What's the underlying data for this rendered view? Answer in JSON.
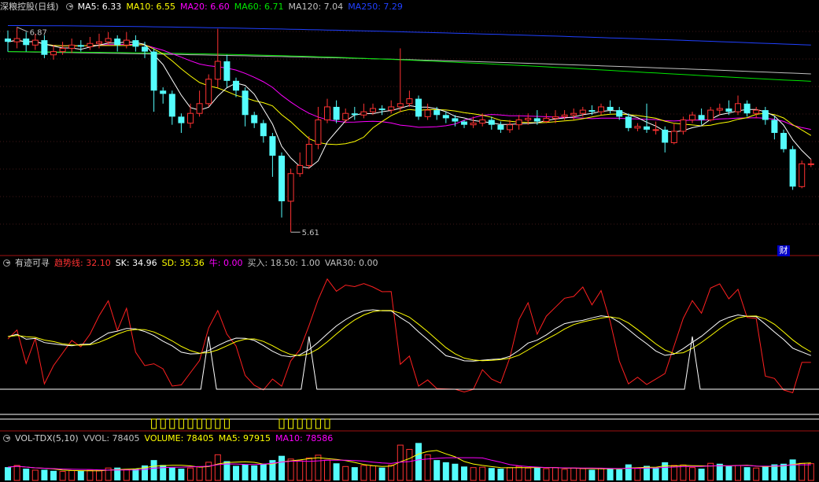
{
  "colors": {
    "up": "#ff3232",
    "down": "#54fcfc",
    "ma5": "#ffffff",
    "ma10": "#ffff00",
    "ma20": "#ff00ff",
    "ma60": "#00e600",
    "ma120": "#c0c0c0",
    "ma250": "#2040ff"
  },
  "main": {
    "title": "深粮控股(日线)",
    "ma5_label": "MA5: 6.33",
    "ma10_label": "MA10: 6.55",
    "ma20_label": "MA20: 6.60",
    "ma60_label": "MA60: 6.71",
    "ma120_label": "MA120: 7.04",
    "ma250_label": "MA250: 7.29",
    "high_label": "6.87",
    "low_label": "5.61",
    "cai_badge": "财"
  },
  "indicator": {
    "title": "有迹可寻",
    "trend_label": "趋势线: 32.10",
    "sk_label": "SK: 34.96",
    "sd_label": "SD: 35.36",
    "niu_label": "牛: 0.00",
    "buy_label": "买入: 18.50",
    "extra_label": ": 1.00",
    "var30_label": "VAR30: 0.00"
  },
  "volume": {
    "title": "VOL-TDX(5,10)",
    "vvol_label": "VVOL: 78405",
    "volume_label": "VOLUME: 78405",
    "ma5_label": "MA5: 97915",
    "ma10_label": "MA10: 78586"
  },
  "chart_data": {
    "type": "candlestick",
    "price_range": [
      5.5,
      6.95
    ],
    "candles": [
      [
        6.8,
        6.78,
        6.85,
        6.72
      ],
      [
        6.78,
        6.8,
        6.87,
        6.74
      ],
      [
        6.8,
        6.76,
        6.84,
        6.72
      ],
      [
        6.76,
        6.79,
        6.83,
        6.73
      ],
      [
        6.79,
        6.7,
        6.82,
        6.68
      ],
      [
        6.7,
        6.72,
        6.76,
        6.67
      ],
      [
        6.72,
        6.74,
        6.78,
        6.7
      ],
      [
        6.74,
        6.76,
        6.8,
        6.71
      ],
      [
        6.76,
        6.75,
        6.79,
        6.72
      ],
      [
        6.75,
        6.77,
        6.81,
        6.73
      ],
      [
        6.77,
        6.78,
        6.83,
        6.74
      ],
      [
        6.78,
        6.8,
        6.84,
        6.76
      ],
      [
        6.8,
        6.76,
        6.82,
        6.72
      ],
      [
        6.76,
        6.79,
        6.84,
        6.74
      ],
      [
        6.79,
        6.75,
        6.82,
        6.72
      ],
      [
        6.75,
        6.72,
        6.78,
        6.68
      ],
      [
        6.72,
        6.48,
        6.74,
        6.35
      ],
      [
        6.48,
        6.46,
        6.5,
        6.4
      ],
      [
        6.46,
        6.32,
        6.48,
        6.27
      ],
      [
        6.32,
        6.28,
        6.34,
        6.22
      ],
      [
        6.28,
        6.34,
        6.4,
        6.25
      ],
      [
        6.34,
        6.4,
        6.48,
        6.32
      ],
      [
        6.4,
        6.55,
        6.58,
        6.38
      ],
      [
        6.55,
        6.66,
        6.86,
        6.5
      ],
      [
        6.66,
        6.54,
        6.7,
        6.5
      ],
      [
        6.54,
        6.48,
        6.56,
        6.44
      ],
      [
        6.48,
        6.33,
        6.5,
        6.26
      ],
      [
        6.33,
        6.28,
        6.35,
        6.25
      ],
      [
        6.28,
        6.2,
        6.3,
        6.16
      ],
      [
        6.2,
        6.08,
        6.22,
        5.95
      ],
      [
        6.08,
        5.8,
        6.1,
        5.7
      ],
      [
        5.8,
        5.97,
        6.0,
        5.61
      ],
      [
        5.97,
        6.02,
        6.1,
        5.95
      ],
      [
        6.02,
        6.15,
        6.2,
        6.0
      ],
      [
        6.15,
        6.3,
        6.38,
        6.12
      ],
      [
        6.3,
        6.38,
        6.43,
        6.28
      ],
      [
        6.38,
        6.3,
        6.42,
        6.28
      ],
      [
        6.3,
        6.34,
        6.37,
        6.28
      ],
      [
        6.34,
        6.33,
        6.38,
        6.3
      ],
      [
        6.33,
        6.35,
        6.4,
        6.31
      ],
      [
        6.35,
        6.37,
        6.4,
        6.33
      ],
      [
        6.37,
        6.36,
        6.39,
        6.33
      ],
      [
        6.36,
        6.38,
        6.42,
        6.34
      ],
      [
        6.38,
        6.4,
        6.74,
        6.35
      ],
      [
        6.4,
        6.43,
        6.48,
        6.38
      ],
      [
        6.43,
        6.32,
        6.45,
        6.3
      ],
      [
        6.32,
        6.36,
        6.4,
        6.3
      ],
      [
        6.36,
        6.33,
        6.38,
        6.3
      ],
      [
        6.33,
        6.31,
        6.35,
        6.28
      ],
      [
        6.31,
        6.29,
        6.33,
        6.26
      ],
      [
        6.29,
        6.27,
        6.3,
        6.25
      ],
      [
        6.27,
        6.28,
        6.32,
        6.25
      ],
      [
        6.28,
        6.3,
        6.34,
        6.26
      ],
      [
        6.3,
        6.27,
        6.32,
        6.24
      ],
      [
        6.27,
        6.24,
        6.29,
        6.22
      ],
      [
        6.24,
        6.27,
        6.3,
        6.22
      ],
      [
        6.27,
        6.3,
        6.33,
        6.24
      ],
      [
        6.3,
        6.31,
        6.34,
        6.27
      ],
      [
        6.31,
        6.29,
        6.36,
        6.27
      ],
      [
        6.29,
        6.31,
        6.34,
        6.28
      ],
      [
        6.31,
        6.32,
        6.36,
        6.28
      ],
      [
        6.32,
        6.33,
        6.36,
        6.3
      ],
      [
        6.33,
        6.34,
        6.37,
        6.3
      ],
      [
        6.34,
        6.36,
        6.38,
        6.32
      ],
      [
        6.36,
        6.35,
        6.39,
        6.33
      ],
      [
        6.35,
        6.38,
        6.4,
        6.33
      ],
      [
        6.38,
        6.36,
        6.42,
        6.34
      ],
      [
        6.36,
        6.32,
        6.38,
        6.3
      ],
      [
        6.32,
        6.25,
        6.34,
        6.23
      ],
      [
        6.25,
        6.26,
        6.28,
        6.23
      ],
      [
        6.26,
        6.24,
        6.4,
        6.22
      ],
      [
        6.24,
        6.24,
        6.29,
        6.21
      ],
      [
        6.24,
        6.16,
        6.26,
        6.1
      ],
      [
        6.16,
        6.23,
        6.28,
        6.15
      ],
      [
        6.23,
        6.3,
        6.32,
        6.21
      ],
      [
        6.3,
        6.33,
        6.35,
        6.28
      ],
      [
        6.33,
        6.3,
        6.37,
        6.27
      ],
      [
        6.3,
        6.36,
        6.38,
        6.29
      ],
      [
        6.36,
        6.37,
        6.4,
        6.33
      ],
      [
        6.37,
        6.35,
        6.42,
        6.33
      ],
      [
        6.35,
        6.4,
        6.45,
        6.33
      ],
      [
        6.4,
        6.34,
        6.42,
        6.32
      ],
      [
        6.34,
        6.36,
        6.38,
        6.31
      ],
      [
        6.36,
        6.3,
        6.38,
        6.27
      ],
      [
        6.3,
        6.22,
        6.32,
        6.18
      ],
      [
        6.22,
        6.12,
        6.24,
        6.1
      ],
      [
        6.12,
        5.89,
        6.14,
        5.87
      ],
      [
        5.89,
        6.03,
        6.05,
        5.88
      ],
      [
        6.03,
        6.03,
        6.06,
        6.01
      ]
    ],
    "volume_range": [
      0,
      180000
    ],
    "volumes": [
      [
        62000,
        "down"
      ],
      [
        70000,
        "up"
      ],
      [
        55000,
        "down"
      ],
      [
        48000,
        "up"
      ],
      [
        50000,
        "down"
      ],
      [
        45000,
        "down"
      ],
      [
        42000,
        "up"
      ],
      [
        46000,
        "up"
      ],
      [
        44000,
        "down"
      ],
      [
        47000,
        "up"
      ],
      [
        45000,
        "up"
      ],
      [
        58000,
        "up"
      ],
      [
        60000,
        "down"
      ],
      [
        52000,
        "up"
      ],
      [
        55000,
        "down"
      ],
      [
        70000,
        "down"
      ],
      [
        95000,
        "down"
      ],
      [
        72000,
        "down"
      ],
      [
        60000,
        "down"
      ],
      [
        55000,
        "down"
      ],
      [
        58000,
        "up"
      ],
      [
        65000,
        "up"
      ],
      [
        85000,
        "up"
      ],
      [
        120000,
        "up"
      ],
      [
        90000,
        "down"
      ],
      [
        68000,
        "down"
      ],
      [
        75000,
        "down"
      ],
      [
        70000,
        "down"
      ],
      [
        78000,
        "down"
      ],
      [
        95000,
        "down"
      ],
      [
        115000,
        "down"
      ],
      [
        100000,
        "up"
      ],
      [
        92000,
        "up"
      ],
      [
        105000,
        "up"
      ],
      [
        118000,
        "up"
      ],
      [
        95000,
        "up"
      ],
      [
        80000,
        "down"
      ],
      [
        65000,
        "up"
      ],
      [
        62000,
        "down"
      ],
      [
        70000,
        "up"
      ],
      [
        68000,
        "up"
      ],
      [
        60000,
        "down"
      ],
      [
        72000,
        "up"
      ],
      [
        165000,
        "up"
      ],
      [
        145000,
        "up"
      ],
      [
        175000,
        "down"
      ],
      [
        120000,
        "up"
      ],
      [
        95000,
        "down"
      ],
      [
        85000,
        "down"
      ],
      [
        78000,
        "down"
      ],
      [
        65000,
        "down"
      ],
      [
        60000,
        "up"
      ],
      [
        62000,
        "up"
      ],
      [
        58000,
        "down"
      ],
      [
        55000,
        "down"
      ],
      [
        60000,
        "up"
      ],
      [
        66000,
        "up"
      ],
      [
        58000,
        "up"
      ],
      [
        62000,
        "down"
      ],
      [
        55000,
        "up"
      ],
      [
        60000,
        "up"
      ],
      [
        52000,
        "up"
      ],
      [
        58000,
        "up"
      ],
      [
        55000,
        "up"
      ],
      [
        50000,
        "down"
      ],
      [
        57000,
        "up"
      ],
      [
        55000,
        "down"
      ],
      [
        52000,
        "down"
      ],
      [
        75000,
        "down"
      ],
      [
        56000,
        "up"
      ],
      [
        68000,
        "down"
      ],
      [
        58000,
        "down"
      ],
      [
        85000,
        "down"
      ],
      [
        70000,
        "up"
      ],
      [
        72000,
        "up"
      ],
      [
        60000,
        "up"
      ],
      [
        55000,
        "down"
      ],
      [
        80000,
        "up"
      ],
      [
        78000,
        "down"
      ],
      [
        66000,
        "down"
      ],
      [
        70000,
        "up"
      ],
      [
        62000,
        "down"
      ],
      [
        58000,
        "up"
      ],
      [
        65000,
        "down"
      ],
      [
        75000,
        "down"
      ],
      [
        78000,
        "down"
      ],
      [
        98000,
        "down"
      ],
      [
        80000,
        "up"
      ],
      [
        78405,
        "up"
      ]
    ]
  }
}
